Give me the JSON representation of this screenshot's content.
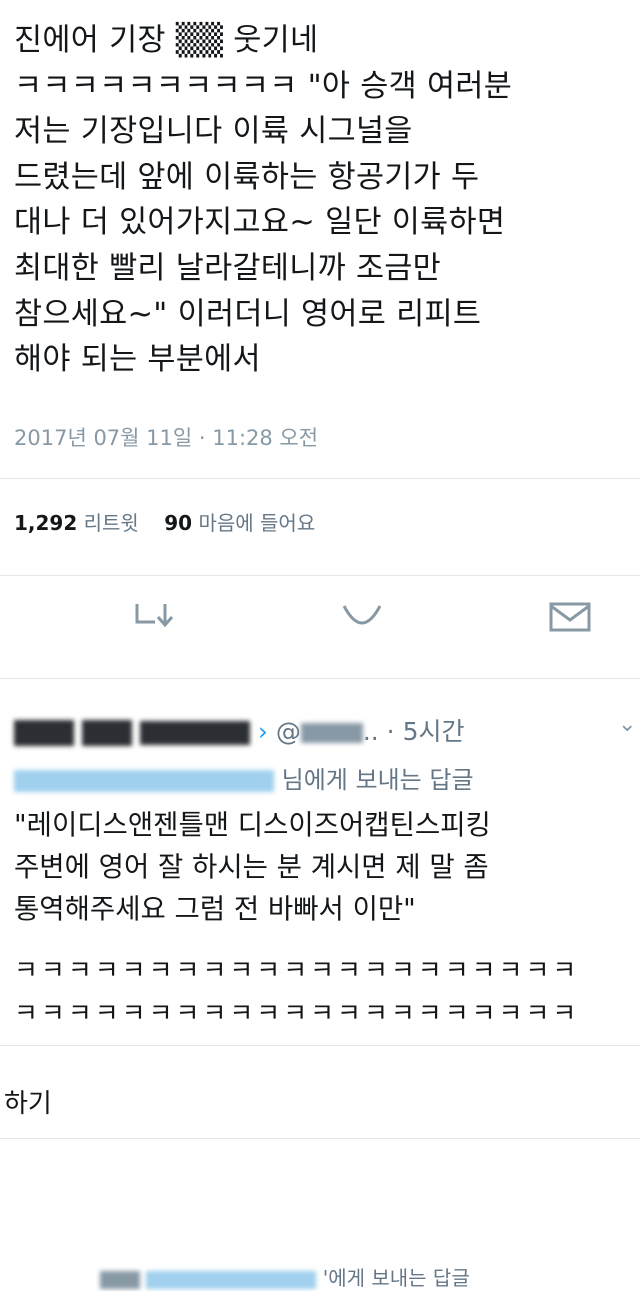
{
  "tweet": {
    "text": "진에어 기장 ▒▒ 웃기네\nㅋㅋㅋㅋㅋㅋㅋㅋㅋㅋ \"아 승객 여러분\n저는 기장입니다 이륙 시그널을\n드렸는데 앞에 이륙하는 항공기가 두\n대나 더 있어가지고요~ 일단 이륙하면\n최대한 빨리 날라갈테니까 조금만\n참으세요~\" 이러더니 영어로 리피트\n해야 되는 부분에서",
    "timestamp": "2017년 07월 11일 · 11:28 오전",
    "retweet_count": "1,292",
    "retweet_label": "리트윗",
    "like_count": "90",
    "like_label": "마음에 들어요"
  },
  "actions": {
    "reply_icon": "reply-icon",
    "like_icon": "heart-icon",
    "dm_icon": "envelope-icon"
  },
  "reply": {
    "handle": "@",
    "dots": "..",
    "time": "· 5시간",
    "replying_to": "님에게 보내는 답글",
    "text": "\"레이디스앤젠틀맨 디스이즈어캡틴스피킹\n주변에 영어 잘 하시는 분 계시면 제 말 좀\n통역해주세요 그럼 전 바빠서 이만\"",
    "laugh_line_1": "ㅋㅋㅋㅋㅋㅋㅋㅋㅋㅋㅋㅋㅋㅋㅋㅋㅋㅋㅋㅋㅋ",
    "laugh_line_2": "ㅋㅋㅋㅋㅋㅋㅋㅋㅋㅋㅋㅋㅋㅋㅋㅋㅋㅋㅋㅋㅋ"
  },
  "more_link": "하기",
  "bottom_reply": {
    "replying_to": "'에게 보내는 답글"
  },
  "colors": {
    "text": "#14171a",
    "secondary": "#657786",
    "link_blue": "#1da1f2",
    "divider": "#e1e8ed"
  }
}
